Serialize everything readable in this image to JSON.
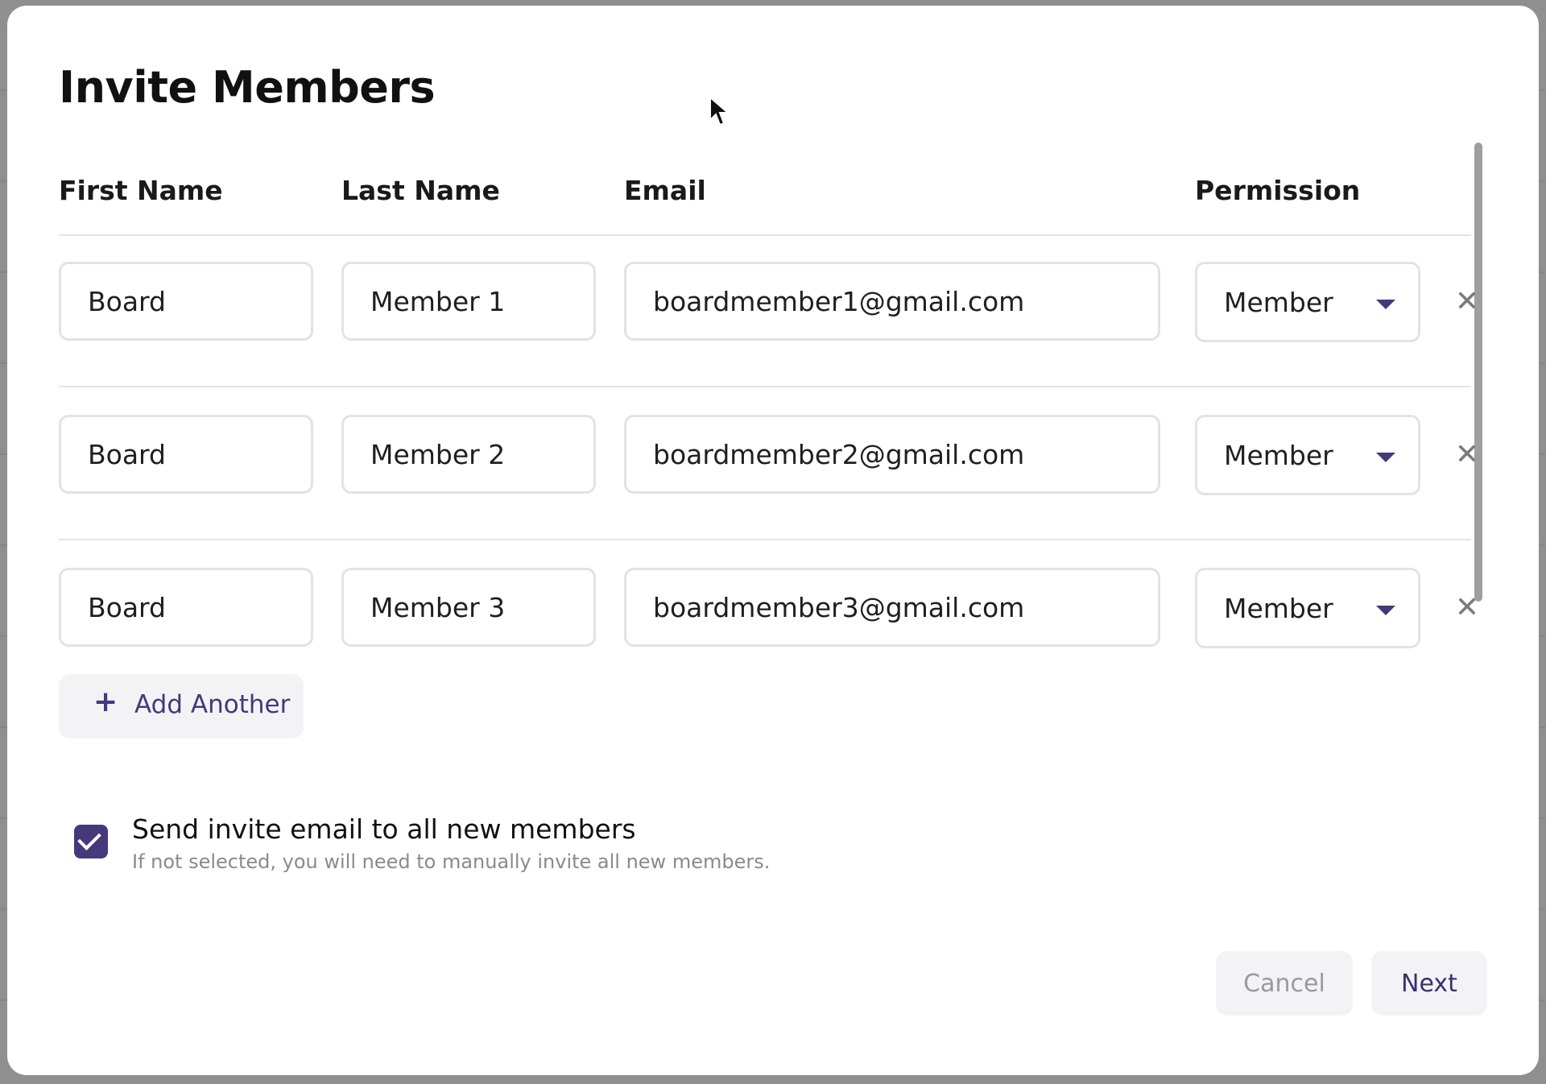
{
  "dialog": {
    "title": "Invite Members"
  },
  "columns": {
    "first_name": "First Name",
    "last_name": "Last Name",
    "email": "Email",
    "permission": "Permission"
  },
  "rows": [
    {
      "first_name": "Board",
      "last_name": "Member 1",
      "email": "boardmember1@gmail.com",
      "permission": "Member"
    },
    {
      "first_name": "Board",
      "last_name": "Member 2",
      "email": "boardmember2@gmail.com",
      "permission": "Member"
    },
    {
      "first_name": "Board",
      "last_name": "Member 3",
      "email": "boardmember3@gmail.com",
      "permission": "Member"
    }
  ],
  "add_another": {
    "label": "Add Another",
    "icon": "plus-icon"
  },
  "send_invite": {
    "checked": true,
    "label": "Send invite email to all new members",
    "description": "If not selected, you will need to manually invite all new members."
  },
  "footer": {
    "cancel_label": "Cancel",
    "next_label": "Next"
  },
  "icons": {
    "remove": "close-icon",
    "dropdown": "chevron-down-icon",
    "check": "check-icon",
    "cursor": "mouse-pointer-icon"
  },
  "colors": {
    "accent": "#46397a",
    "border": "#e2e2e8",
    "button_bg": "#f3f3f5"
  }
}
